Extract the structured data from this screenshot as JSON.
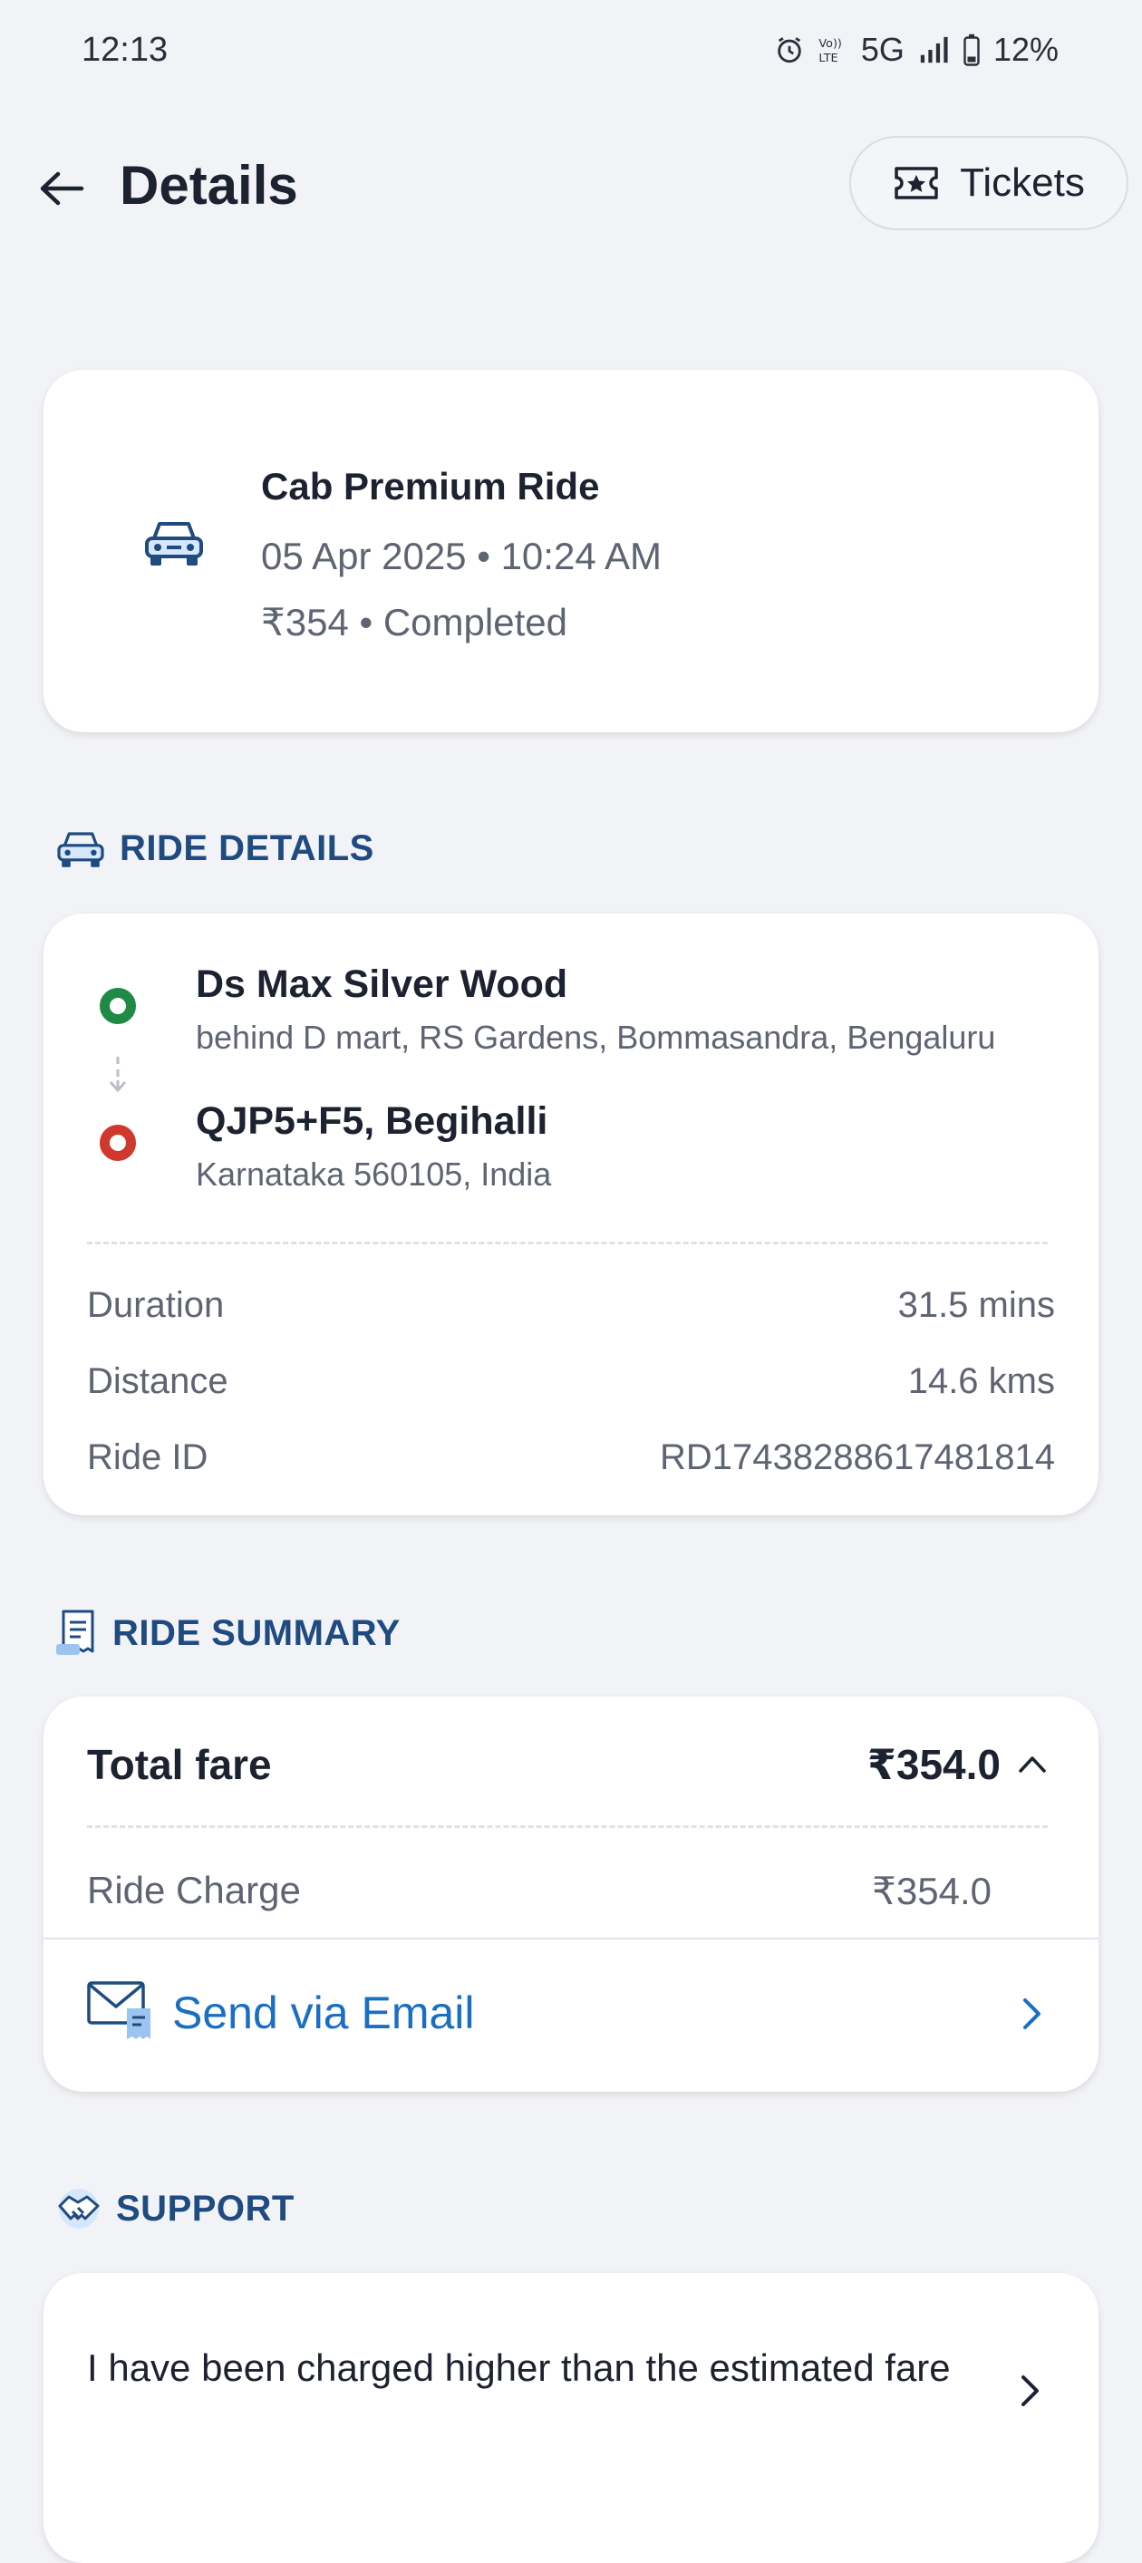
{
  "status_bar": {
    "time": "12:13",
    "network": "5G",
    "battery": "12%"
  },
  "header": {
    "title": "Details",
    "tickets_label": "Tickets"
  },
  "ride": {
    "title": "Cab Premium Ride",
    "date_time": "05 Apr 2025 • 10:24 AM",
    "price_status": "₹354 • Completed"
  },
  "ride_details": {
    "section_title": "RIDE DETAILS",
    "pickup_name": "Ds Max Silver Wood",
    "pickup_address": "behind D mart, RS Gardens, Bommasandra, Bengaluru",
    "drop_name": "QJP5+F5, Begihalli",
    "drop_address": "Karnataka 560105, India",
    "duration_label": "Duration",
    "duration_value": "31.5 mins",
    "distance_label": "Distance",
    "distance_value": "14.6 kms",
    "ride_id_label": "Ride ID",
    "ride_id_value": "RD17438288617481814"
  },
  "ride_summary": {
    "section_title": "RIDE SUMMARY",
    "total_fare_label": "Total fare",
    "total_fare_value": "₹354.0",
    "ride_charge_label": "Ride Charge",
    "ride_charge_value": "₹354.0",
    "send_email_label": "Send via Email"
  },
  "support": {
    "section_title": "SUPPORT",
    "item_1": "I have been charged higher than the estimated fare"
  },
  "colors": {
    "accent_blue": "#1a6fc2",
    "section_title": "#1f4b80",
    "pickup_green": "#1e8a46",
    "drop_red": "#d0382d"
  }
}
